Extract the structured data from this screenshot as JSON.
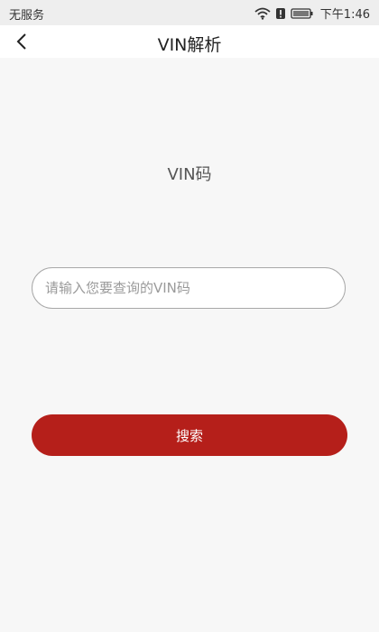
{
  "status_bar": {
    "carrier": "无服务",
    "time": "下午1:46",
    "icons": [
      "wifi-icon",
      "alert-icon",
      "battery-icon"
    ]
  },
  "header": {
    "title": "VIN解析",
    "back_icon": "chevron-left-icon"
  },
  "main": {
    "label": "VIN码",
    "search": {
      "placeholder": "请输入您要查询的VIN码",
      "value": ""
    },
    "search_button_label": "搜索"
  },
  "colors": {
    "accent": "#b51f1a",
    "background": "#f7f7f7",
    "status_bar_bg": "#eeeeee",
    "header_bg": "#ffffff"
  }
}
